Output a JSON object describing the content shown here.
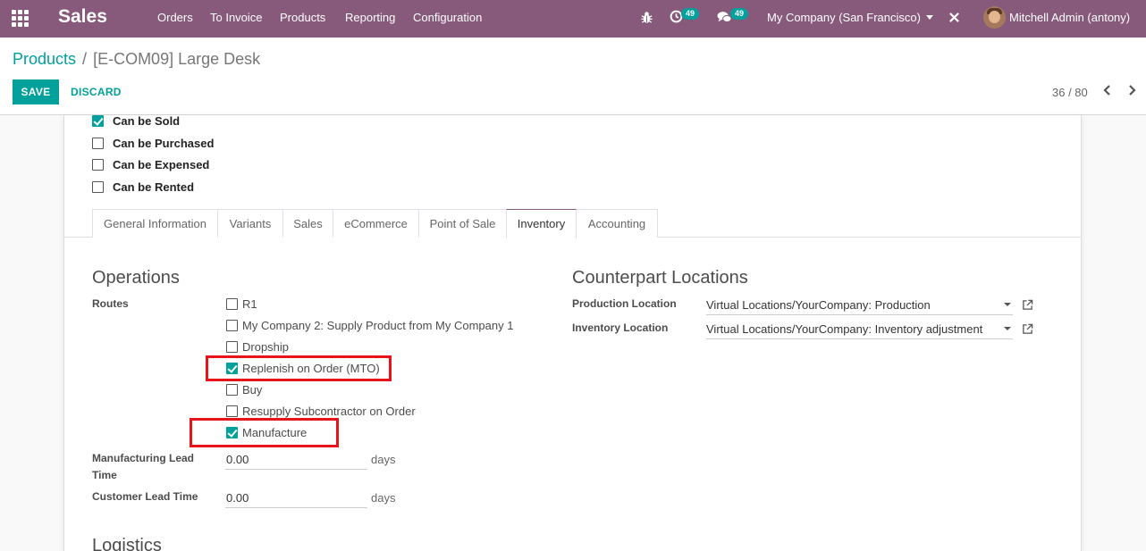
{
  "app": {
    "name": "Sales"
  },
  "menu": [
    "Orders",
    "To Invoice",
    "Products",
    "Reporting",
    "Configuration"
  ],
  "systray": {
    "activity_count": "49",
    "message_count": "49",
    "company": "My Company (San Francisco)",
    "user": "Mitchell Admin (antony)"
  },
  "breadcrumb": {
    "parent": "Products",
    "current": "[E-COM09] Large Desk"
  },
  "actions": {
    "save": "SAVE",
    "discard": "DISCARD"
  },
  "pager": {
    "text": "36 / 80"
  },
  "options": [
    {
      "label": "Can be Sold",
      "checked": true
    },
    {
      "label": "Can be Purchased",
      "checked": false
    },
    {
      "label": "Can be Expensed",
      "checked": false
    },
    {
      "label": "Can be Rented",
      "checked": false
    }
  ],
  "tabs": [
    "General Information",
    "Variants",
    "Sales",
    "eCommerce",
    "Point of Sale",
    "Inventory",
    "Accounting"
  ],
  "active_tab": "Inventory",
  "operations": {
    "title": "Operations",
    "routes_label": "Routes",
    "routes": [
      {
        "label": "R1",
        "checked": false
      },
      {
        "label": "My Company 2: Supply Product from My Company 1",
        "checked": false
      },
      {
        "label": "Dropship",
        "checked": false
      },
      {
        "label": "Replenish on Order (MTO)",
        "checked": true
      },
      {
        "label": "Buy",
        "checked": false
      },
      {
        "label": "Resupply Subcontractor on Order",
        "checked": false
      },
      {
        "label": "Manufacture",
        "checked": true
      }
    ],
    "manufacturing_lead_time": {
      "label": "Manufacturing Lead Time",
      "value": "0.00",
      "unit": "days"
    },
    "customer_lead_time": {
      "label": "Customer Lead Time",
      "value": "0.00",
      "unit": "days"
    }
  },
  "counterpart": {
    "title": "Counterpart Locations",
    "production_location": {
      "label": "Production Location",
      "value": "Virtual Locations/YourCompany: Production"
    },
    "inventory_location": {
      "label": "Inventory Location",
      "value": "Virtual Locations/YourCompany: Inventory adjustment"
    }
  },
  "logistics": {
    "title": "Logistics"
  },
  "colors": {
    "navbar": "#875a7b",
    "primary": "#00a09d",
    "highlight": "#e8141a"
  }
}
